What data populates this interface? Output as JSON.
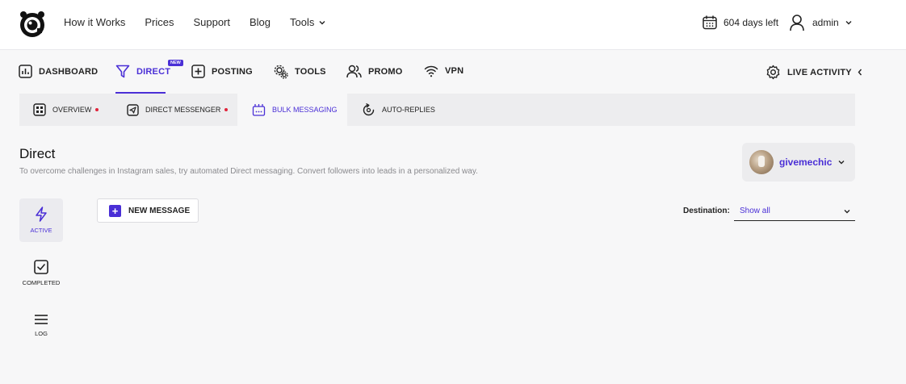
{
  "header": {
    "nav_links": [
      "How it Works",
      "Prices",
      "Support",
      "Blog"
    ],
    "tools_label": "Tools",
    "days_left": "604 days left",
    "username": "admin"
  },
  "main_nav": {
    "tabs": [
      {
        "label": "DASHBOARD",
        "icon": "dashboard-chart-icon"
      },
      {
        "label": "DIRECT",
        "icon": "funnel-icon",
        "active": true,
        "badge": "NEW"
      },
      {
        "label": "POSTING",
        "icon": "plus-square-icon"
      },
      {
        "label": "TOOLS",
        "icon": "gears-icon"
      },
      {
        "label": "PROMO",
        "icon": "users-icon"
      },
      {
        "label": "VPN",
        "icon": "wifi-icon"
      }
    ],
    "live_activity": "LIVE ACTIVITY"
  },
  "sub_tabs": [
    {
      "label": "OVERVIEW",
      "has_dot": true
    },
    {
      "label": "DIRECT MESSENGER",
      "has_dot": true
    },
    {
      "label": "BULK MESSAGING",
      "active": true
    },
    {
      "label": "AUTO-REPLIES"
    }
  ],
  "page": {
    "title": "Direct",
    "subtitle": "To overcome challenges in Instagram sales, try automated Direct messaging. Convert followers into leads in a personalized way.",
    "account": "givemechic"
  },
  "side_menu": [
    {
      "label": "ACTIVE",
      "active": true
    },
    {
      "label": "COMPLETED"
    },
    {
      "label": "LOG"
    }
  ],
  "toolbar": {
    "new_message": "NEW MESSAGE",
    "destination_label": "Destination:",
    "destination_value": "Show all"
  },
  "colors": {
    "accent": "#4a2fd6",
    "dot": "#e0243b",
    "background": "#f7f7f8"
  }
}
